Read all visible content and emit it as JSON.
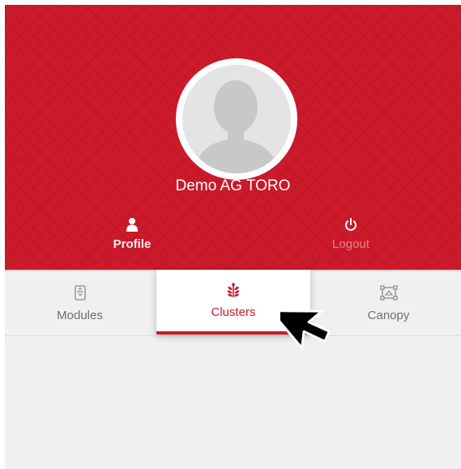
{
  "user": {
    "name": "Demo AG TORO"
  },
  "header_actions": [
    {
      "label": "Profile",
      "icon": "person-icon"
    },
    {
      "label": "Logout",
      "icon": "power-icon"
    }
  ],
  "tabs": [
    {
      "label": "Modules",
      "icon": "module-icon",
      "active": false
    },
    {
      "label": "Clusters",
      "icon": "cluster-icon",
      "active": true
    },
    {
      "label": "Canopy",
      "icon": "canopy-icon",
      "active": false
    }
  ],
  "colors": {
    "brand_red": "#cc1a2b",
    "tab_bar": "#f0f0f0",
    "inactive_text": "#6e6e6e"
  }
}
